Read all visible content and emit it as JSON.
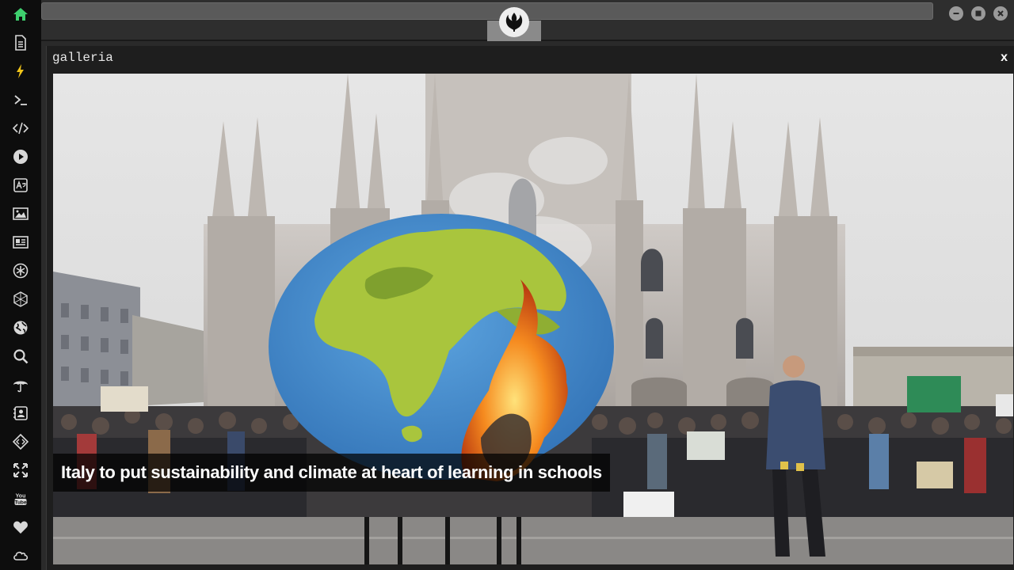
{
  "dock": {
    "items": [
      {
        "name": "home-icon",
        "color": "#3ecf6e"
      },
      {
        "name": "document-icon"
      },
      {
        "name": "lightning-icon",
        "color": "#f0c419"
      },
      {
        "name": "terminal-icon"
      },
      {
        "name": "code-icon"
      },
      {
        "name": "play-icon"
      },
      {
        "name": "translate-icon"
      },
      {
        "name": "image-icon"
      },
      {
        "name": "newspaper-icon"
      },
      {
        "name": "asterisk-icon"
      },
      {
        "name": "network-icon"
      },
      {
        "name": "globe-icon"
      },
      {
        "name": "search-icon"
      },
      {
        "name": "umbrella-icon"
      },
      {
        "name": "contact-icon"
      },
      {
        "name": "dev-icon"
      },
      {
        "name": "expand-icon"
      },
      {
        "name": "youtube-icon",
        "label": "You Tube"
      },
      {
        "name": "heart-icon"
      },
      {
        "name": "cloud-icon"
      }
    ]
  },
  "window": {
    "controls": [
      "minimize-icon",
      "maximize-icon",
      "close-icon"
    ]
  },
  "gallery": {
    "title": "galleria",
    "close_label": "x",
    "caption": "Italy to put sustainability and climate at heart of learning in schools"
  }
}
